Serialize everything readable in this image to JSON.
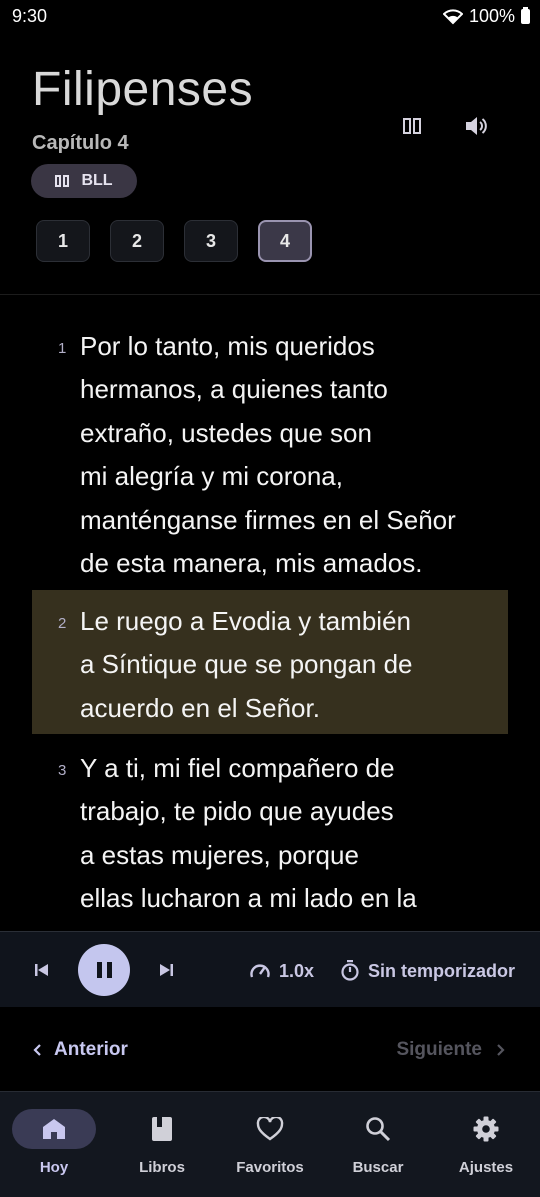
{
  "status": {
    "time": "9:30",
    "battery": "100%"
  },
  "header": {
    "book": "Filipenses",
    "chapter_label": "Capítulo 4",
    "version": "BLL",
    "chapters": [
      "1",
      "2",
      "3",
      "4"
    ],
    "active_chapter": "4"
  },
  "verses": [
    {
      "num": "1",
      "text": "Por lo tanto, mis queridos\nhermanos, a quienes tanto\nextraño, ustedes que son\nmi alegría y mi corona,\nmanténganse firmes en el Señor\nde esta manera, mis amados."
    },
    {
      "num": "2",
      "text": "Le ruego a Evodia y también\na Síntique que se pongan de\nacuerdo en el Señor."
    },
    {
      "num": "3",
      "text": "Y a ti, mi fiel compañero de\ntrabajo, te pido que ayudes\na estas mujeres, porque\nellas lucharon a mi lado en la\npredicación del evangelio"
    }
  ],
  "player": {
    "speed": "1.0x",
    "timer": "Sin temporizador"
  },
  "nav": {
    "prev": "Anterior",
    "next": "Siguiente"
  },
  "tabs": [
    {
      "label": "Hoy",
      "icon": "home-icon"
    },
    {
      "label": "Libros",
      "icon": "book-icon"
    },
    {
      "label": "Favoritos",
      "icon": "heart-icon"
    },
    {
      "label": "Buscar",
      "icon": "search-icon"
    },
    {
      "label": "Ajustes",
      "icon": "gear-icon"
    }
  ],
  "colors": {
    "accent": "#c4c6ee",
    "highlight": "#36301e",
    "background": "#000000"
  }
}
